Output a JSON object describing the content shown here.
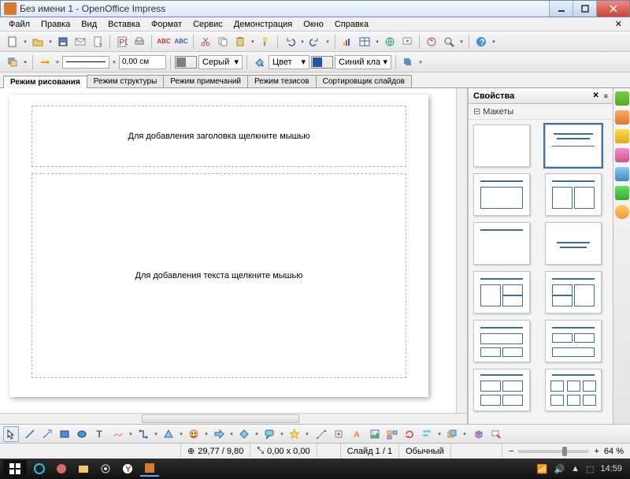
{
  "window": {
    "title": "Без имени 1 - OpenOffice Impress"
  },
  "menu": {
    "items": [
      "Файл",
      "Правка",
      "Вид",
      "Вставка",
      "Формат",
      "Сервис",
      "Демонстрация",
      "Окно",
      "Справка"
    ]
  },
  "toolbar2": {
    "linewidth": "0,00 см",
    "colorname": "Серый",
    "filllabel": "Цвет",
    "fillcolor": "Синий кла"
  },
  "viewtabs": [
    "Режим рисования",
    "Режим структуры",
    "Режим примечаний",
    "Режим тезисов",
    "Сортировщик слайдов"
  ],
  "slide": {
    "title_placeholder": "Для добавления заголовка щелкните мышью",
    "content_placeholder": "Для добавления текста щелкните мышью"
  },
  "sidebar": {
    "panel_title": "Свойства",
    "section": "Макеты"
  },
  "status": {
    "pos": "29,77 / 9,80",
    "size": "0,00 x 0,00",
    "slide": "Слайд 1 / 1",
    "mode": "Обычный",
    "zoom": "64 %"
  },
  "taskbar": {
    "time": "14:59"
  }
}
